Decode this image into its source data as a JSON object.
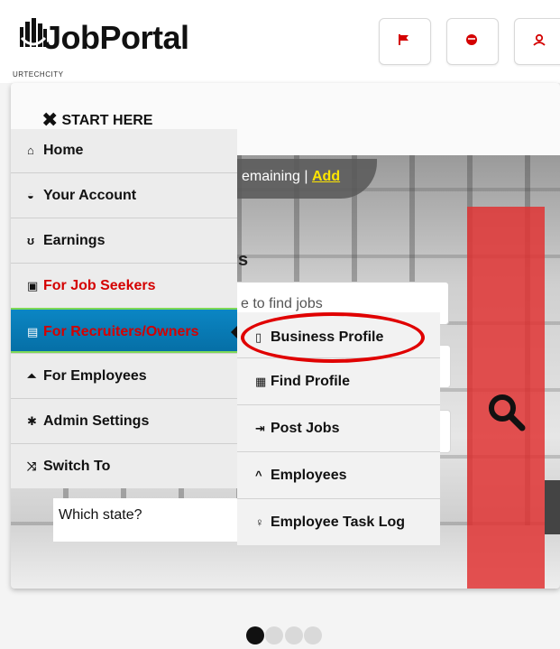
{
  "header": {
    "brand": "JobPortal",
    "brand_sub": "URTECHCITY",
    "buttons": [
      {
        "icon": "flag-icon",
        "color": "#d40000"
      },
      {
        "icon": "account-icon",
        "color": "#d40000"
      },
      {
        "icon": "user-icon",
        "color": "#d40000"
      }
    ]
  },
  "start_label": "START HERE",
  "menu": {
    "items": [
      {
        "icon": "home-icon",
        "glyph": "⌂",
        "label": "Home"
      },
      {
        "icon": "account-icon",
        "glyph": "◒",
        "label": "Your Account"
      },
      {
        "icon": "earnings-icon",
        "glyph": "ʊ",
        "label": "Earnings"
      },
      {
        "icon": "job-seekers-icon",
        "glyph": "▣",
        "label": "For Job Seekers"
      },
      {
        "icon": "recruiters-icon",
        "glyph": "▤",
        "label": "For Recruiters/Owners"
      },
      {
        "icon": "employees-icon",
        "glyph": "⏶",
        "label": "For Employees"
      },
      {
        "icon": "gear-icon",
        "glyph": "✱",
        "label": "Admin Settings"
      },
      {
        "icon": "shuffle-icon",
        "glyph": "⤨",
        "label": "Switch To"
      }
    ]
  },
  "submenu": {
    "items": [
      {
        "icon": "business-profile-icon",
        "glyph": "▯",
        "label": "Business Profile"
      },
      {
        "icon": "find-profile-icon",
        "glyph": "▦",
        "label": "Find Profile"
      },
      {
        "icon": "post-jobs-icon",
        "glyph": "⇥",
        "label": "Post Jobs"
      },
      {
        "icon": "chevron-up-icon",
        "glyph": "^",
        "label": "Employees"
      },
      {
        "icon": "lightbulb-icon",
        "glyph": "♀",
        "label": "Employee Task Log"
      }
    ]
  },
  "hero": {
    "remaining_text": "emaining | ",
    "add_link": "Add",
    "title_fragment": "s",
    "search_placeholder": "e to find jobs",
    "state_placeholder": "Which state?"
  },
  "carousel": {
    "count": 4,
    "active": 1
  },
  "colors": {
    "accent_red": "#d40000",
    "active_blue": "#0b86c4",
    "search_red": "#e03434"
  }
}
